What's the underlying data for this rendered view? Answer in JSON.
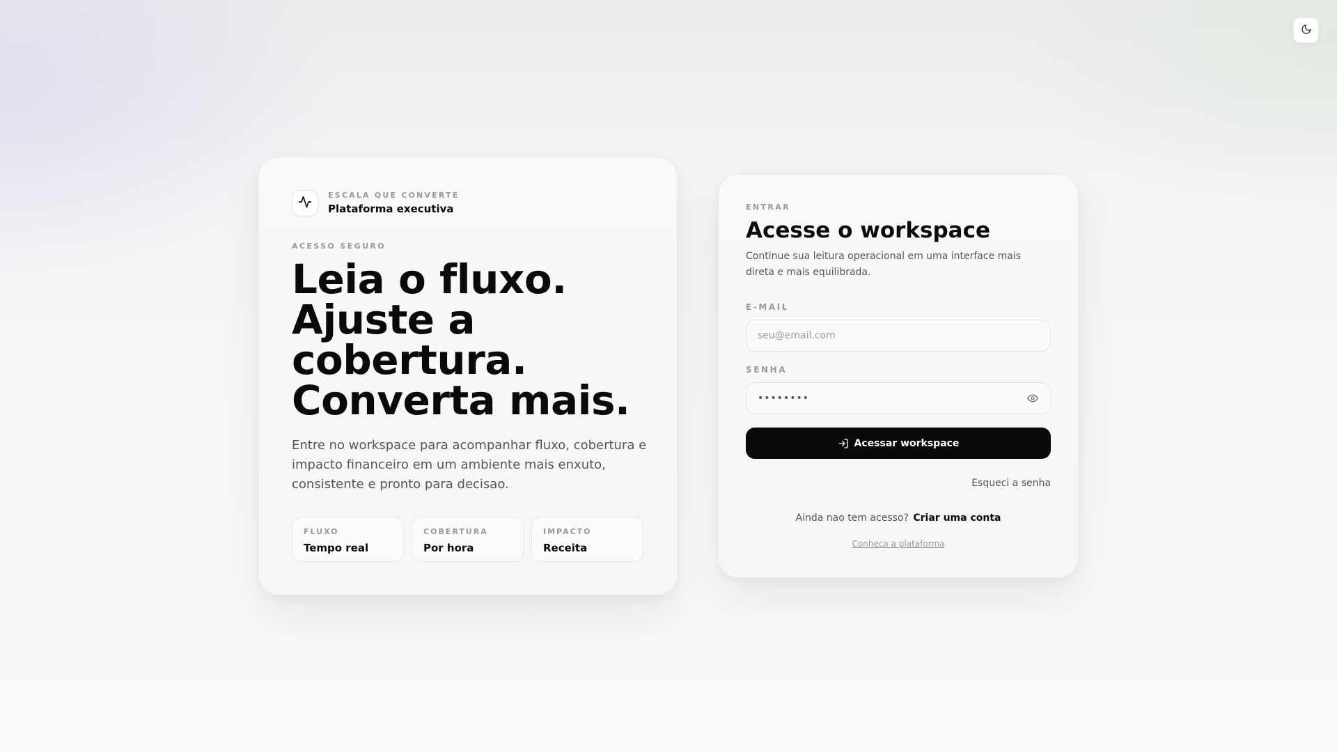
{
  "theme_toggle": {
    "icon": "moon-icon"
  },
  "hero": {
    "brand": {
      "kicker": "ESCALA QUE CONVERTE",
      "name": "Plataforma executiva",
      "icon": "activity-pulse-icon"
    },
    "eyebrow": "ACESSO SEGURO",
    "title_lines": [
      "Leia o fluxo.",
      "Ajuste a",
      "cobertura.",
      "Converta mais."
    ],
    "description": "Entre no workspace para acompanhar fluxo, cobertura e impacto financeiro em um ambiente mais enxuto, consistente e pronto para decisao.",
    "stats": [
      {
        "label": "FLUXO",
        "value": "Tempo real"
      },
      {
        "label": "COBERTURA",
        "value": "Por hora"
      },
      {
        "label": "IMPACTO",
        "value": "Receita"
      }
    ]
  },
  "login": {
    "eyebrow": "ENTRAR",
    "title": "Acesse o workspace",
    "description": "Continue sua leitura operacional em uma interface mais direta e mais equilibrada.",
    "email": {
      "label": "E-MAIL",
      "placeholder": "seu@email.com",
      "value": ""
    },
    "password": {
      "label": "SENHA",
      "masked_value": "••••••••",
      "toggle_icon": "eye-icon"
    },
    "submit": {
      "label": "Acessar workspace",
      "icon": "log-in-icon"
    },
    "forgot": "Esqueci a senha",
    "signup": {
      "prompt": "Ainda nao tem acesso?",
      "link": "Criar uma conta"
    },
    "platform_link": "Conheca a plataforma"
  },
  "colors": {
    "primary": "#0a0a0a",
    "muted": "#9a9a9e",
    "text": "#55555a",
    "card": "#f8f8f8"
  }
}
